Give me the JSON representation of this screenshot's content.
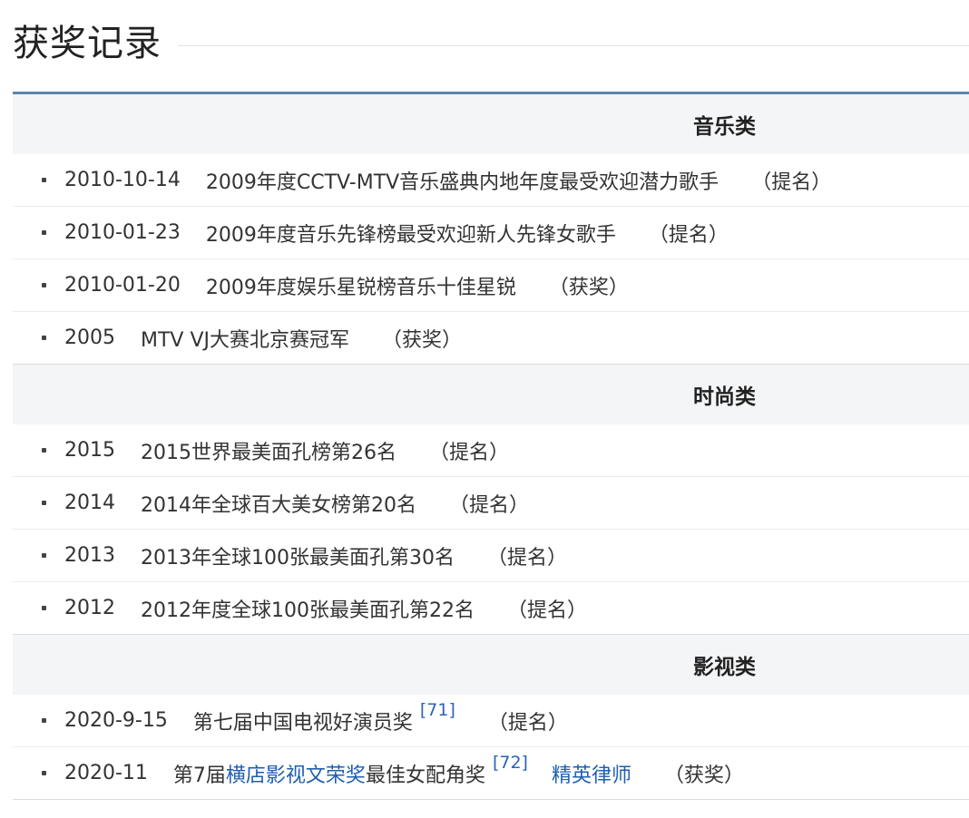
{
  "heading": "获奖记录",
  "categories": [
    {
      "title": "音乐类",
      "rows": [
        {
          "date": "2010-10-14",
          "award": "2009年度CCTV-MTV音乐盛典内地年度最受欢迎潜力歌手",
          "status": "（提名）"
        },
        {
          "date": "2010-01-23",
          "award": "2009年度音乐先锋榜最受欢迎新人先锋女歌手",
          "status": "（提名）"
        },
        {
          "date": "2010-01-20",
          "award": "2009年度娱乐星锐榜音乐十佳星锐",
          "status": "（获奖）"
        },
        {
          "date": "2005",
          "award": "MTV VJ大赛北京赛冠军",
          "status": "（获奖）"
        }
      ]
    },
    {
      "title": "时尚类",
      "rows": [
        {
          "date": "2015",
          "award": "2015世界最美面孔榜第26名",
          "status": "（提名）"
        },
        {
          "date": "2014",
          "award": "2014年全球百大美女榜第20名",
          "status": "（提名）"
        },
        {
          "date": "2013",
          "award": "2013年全球100张最美面孔第30名",
          "status": "（提名）"
        },
        {
          "date": "2012",
          "award": "2012年度全球100张最美面孔第22名",
          "status": "（提名）"
        }
      ]
    },
    {
      "title": "影视类",
      "rows": [
        {
          "date": "2020-9-15",
          "award": "第七届中国电视好演员奖",
          "cite": "[71]",
          "status": "（提名）"
        },
        {
          "date": "2020-11",
          "award_prefix": "第7届",
          "award_link": "横店影视文荣奖",
          "award_suffix": "最佳女配角奖",
          "cite": "[72]",
          "work": "精英律师",
          "status": "（获奖）"
        }
      ]
    }
  ]
}
